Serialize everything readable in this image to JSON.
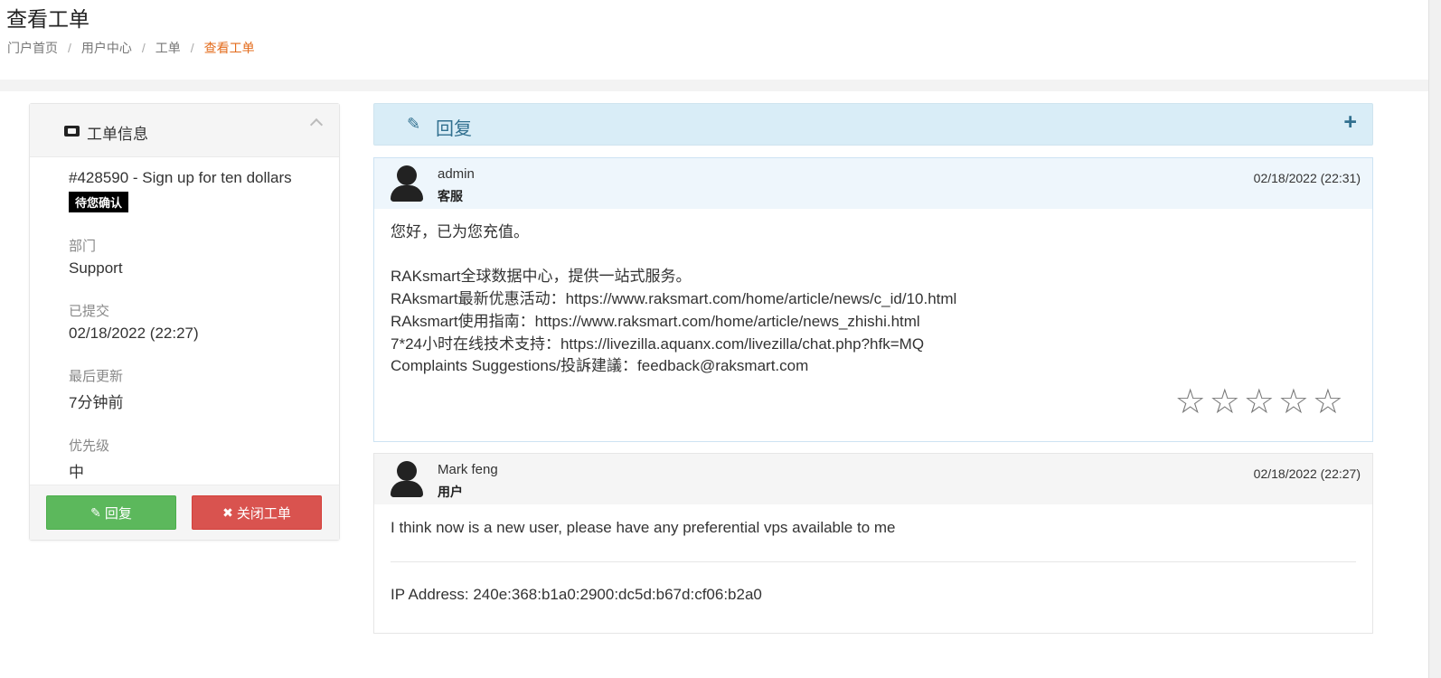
{
  "header": {
    "page_title": "查看工单",
    "breadcrumb": [
      "门户首页",
      "用户中心",
      "工单",
      "查看工单"
    ],
    "breadcrumb_sep": "/"
  },
  "sidebar": {
    "title": "工单信息",
    "subject": "#428590 - Sign up for ten dollars",
    "status": "待您确认",
    "fields": [
      {
        "label": "部门",
        "value": "Support"
      },
      {
        "label": "已提交",
        "value": "02/18/2022 (22:27)"
      },
      {
        "label": "最后更新",
        "value": "7分钟前"
      },
      {
        "label": "优先级",
        "value": "中"
      }
    ],
    "reply_button": "回复",
    "close_button": "关闭工单"
  },
  "reply_bar": {
    "title": "回复",
    "expand_glyph": "+"
  },
  "messages": [
    {
      "name": "admin",
      "role": "客服",
      "date": "02/18/2022 (22:31)",
      "lines": [
        "您好，已为您充值。",
        "",
        "RAKsmart全球数据中心，提供一站式服务。",
        "RAksmart最新优惠活动：https://www.raksmart.com/home/article/news/c_id/10.html",
        "RAksmart使用指南：https://www.raksmart.com/home/article/news_zhishi.html",
        "7*24小时在线技术支持：https://livezilla.aquanx.com/livezilla/chat.php?hfk=MQ",
        "Complaints Suggestions/投訴建議：feedback@raksmart.com"
      ],
      "rating": {
        "max": 5,
        "value": 0
      }
    },
    {
      "name": "Mark feng",
      "role": "用户",
      "date": "02/18/2022 (22:27)",
      "lines": [
        "I think now is a new user, please have any preferential vps available to me"
      ],
      "ip": "IP Address: 240e:368:b1a0:2900:dc5d:b67d:cf06:b2a0"
    }
  ],
  "colors": {
    "breadcrumb_active": "#e36c1d",
    "reply_button": "#5cb85c",
    "close_button": "#d9534f",
    "reply_bar_bg": "#d9edf7",
    "reply_bar_text": "#31708f"
  },
  "icons": {
    "ticket": "ticket-icon",
    "collapse": "chevron-up-icon",
    "pencil": "pencil-icon",
    "close": "times-icon",
    "plus": "plus-icon",
    "avatar": "user-icon",
    "star": "star-outline-icon"
  }
}
